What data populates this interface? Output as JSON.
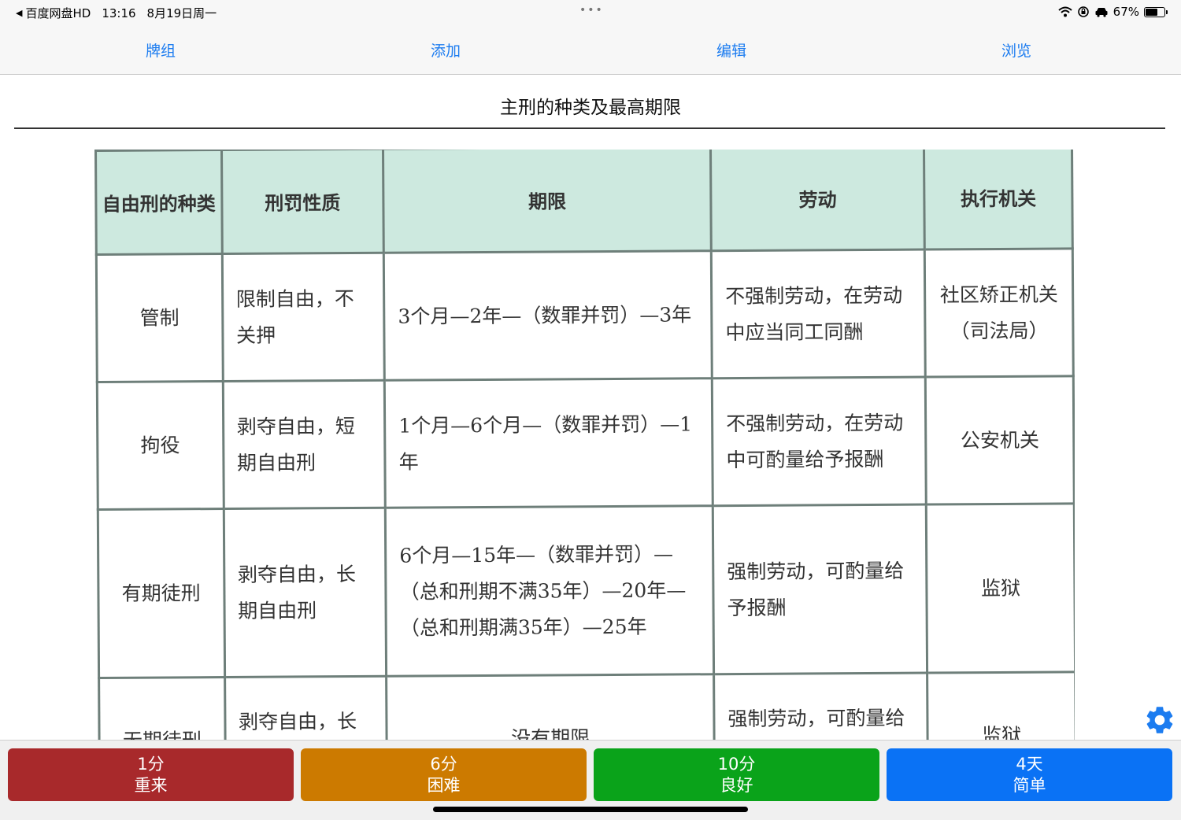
{
  "status_bar": {
    "back_app": "百度网盘HD",
    "time": "13:16",
    "date": "8月19日周一",
    "dots": "•••",
    "battery": "67%",
    "battery_level": 0.67
  },
  "toolbar": {
    "decks": "牌组",
    "add": "添加",
    "edit": "编辑",
    "browse": "浏览"
  },
  "card": {
    "title": "主刑的种类及最高期限",
    "table": {
      "headers": [
        "自由刑的种类",
        "刑罚性质",
        "期限",
        "劳动",
        "执行机关"
      ],
      "rows": [
        [
          "管制",
          "限制自由，不关押",
          "3个月—2年—（数罪并罚）—3年",
          "不强制劳动，在劳动中应当同工同酬",
          "社区矫正机关（司法局）"
        ],
        [
          "拘役",
          "剥夺自由，短期自由刑",
          "1个月—6个月—（数罪并罚）—1年",
          "不强制劳动，在劳动中可酌量给予报酬",
          "公安机关"
        ],
        [
          "有期徒刑",
          "剥夺自由，长期自由刑",
          "6个月—15年—（数罪并罚）—（总和刑期不满35年）—20年—（总和刑期满35年）—25年",
          "强制劳动，可酌量给予报酬",
          "监狱"
        ],
        [
          "无期徒刑",
          "剥夺自由，长期自由刑",
          "没有期限",
          "强制劳动，可酌量给予报酬",
          "监狱"
        ]
      ]
    }
  },
  "answers": [
    {
      "interval": "1分",
      "label": "重来",
      "color": "#a8292b"
    },
    {
      "interval": "6分",
      "label": "困难",
      "color": "#cc7a00"
    },
    {
      "interval": "10分",
      "label": "良好",
      "color": "#0aa31a"
    },
    {
      "interval": "4天",
      "label": "简单",
      "color": "#0a72f5"
    }
  ],
  "icons": {
    "settings": "gear-icon",
    "wifi": "wifi-icon",
    "lock_rotation": "orientation-lock-icon",
    "car": "car-icon",
    "battery": "battery-icon"
  },
  "colors": {
    "accent": "#1c7cf0",
    "table_header_bg": "#cde9df"
  }
}
